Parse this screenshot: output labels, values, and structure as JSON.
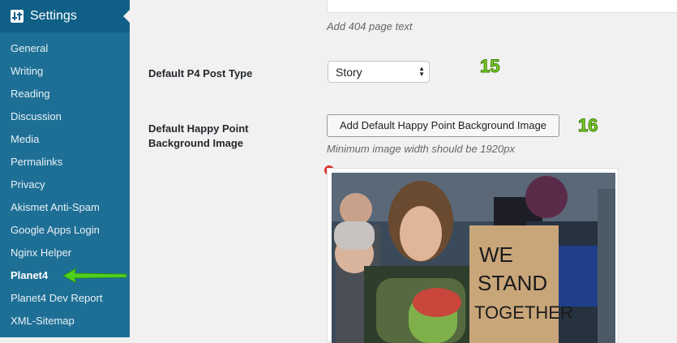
{
  "sidebar": {
    "title": "Settings",
    "items": [
      {
        "label": "General"
      },
      {
        "label": "Writing"
      },
      {
        "label": "Reading"
      },
      {
        "label": "Discussion"
      },
      {
        "label": "Media"
      },
      {
        "label": "Permalinks"
      },
      {
        "label": "Privacy"
      },
      {
        "label": "Akismet Anti-Spam"
      },
      {
        "label": "Google Apps Login"
      },
      {
        "label": "Nginx Helper"
      },
      {
        "label": "Planet4"
      },
      {
        "label": "Planet4 Dev Report"
      },
      {
        "label": "XML-Sitemap"
      }
    ],
    "current": "Planet4"
  },
  "settings": {
    "page404_desc": "Add 404 page text",
    "post_type": {
      "label": "Default P4 Post Type",
      "value": "Story",
      "badge": "15"
    },
    "happy_point": {
      "label": "Default Happy Point Background Image",
      "button": "Add Default Happy Point Background Image",
      "badge": "16",
      "desc": "Minimum image width should be 1920px"
    },
    "image": {
      "sign_text": [
        "WE",
        "STAND",
        "TOGETHER"
      ]
    }
  },
  "colors": {
    "sidebar": "#1e6f95",
    "sidebar_head": "#0f5f86",
    "accent_green": "#7ed321"
  }
}
